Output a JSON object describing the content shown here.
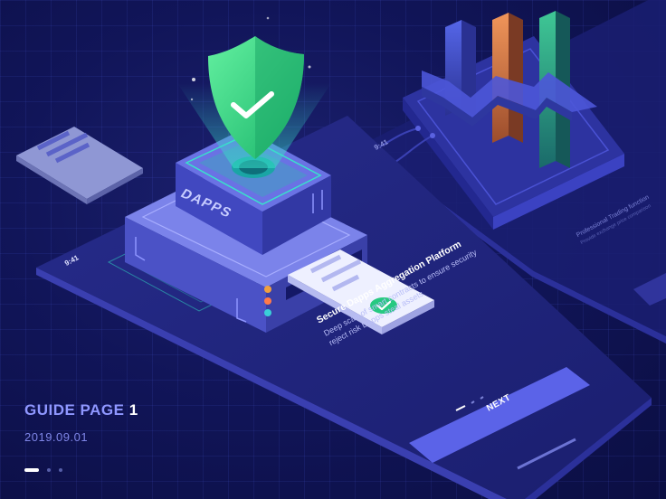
{
  "guide": {
    "title_prefix": "GUIDE PAGE",
    "title_number": "1",
    "date": "2019.09.01",
    "pager_count": 3,
    "pager_active": 0
  },
  "front_screen": {
    "time": "9:41",
    "headline": "Secure Dapps Aggregation Platform",
    "body_line1": "Deep scan of smart contracts to ensure security",
    "body_line2": "reject risk Dapps steal assets",
    "button_label": "NEXT",
    "server_label": "DAPPS"
  },
  "back_screen": {
    "time": "9:41",
    "headline": "Professional Trading function",
    "body_line1": "Provide exchange price comparison"
  },
  "colors": {
    "background": "#111559",
    "accent": "#6c63ff",
    "shield": "#3ddc84",
    "bar_orange": "#e07a3c",
    "bar_green": "#2aa37a",
    "bar_blue": "#3e4fd0"
  },
  "icons": [
    "shield-check-icon",
    "check-icon",
    "document-icon"
  ]
}
